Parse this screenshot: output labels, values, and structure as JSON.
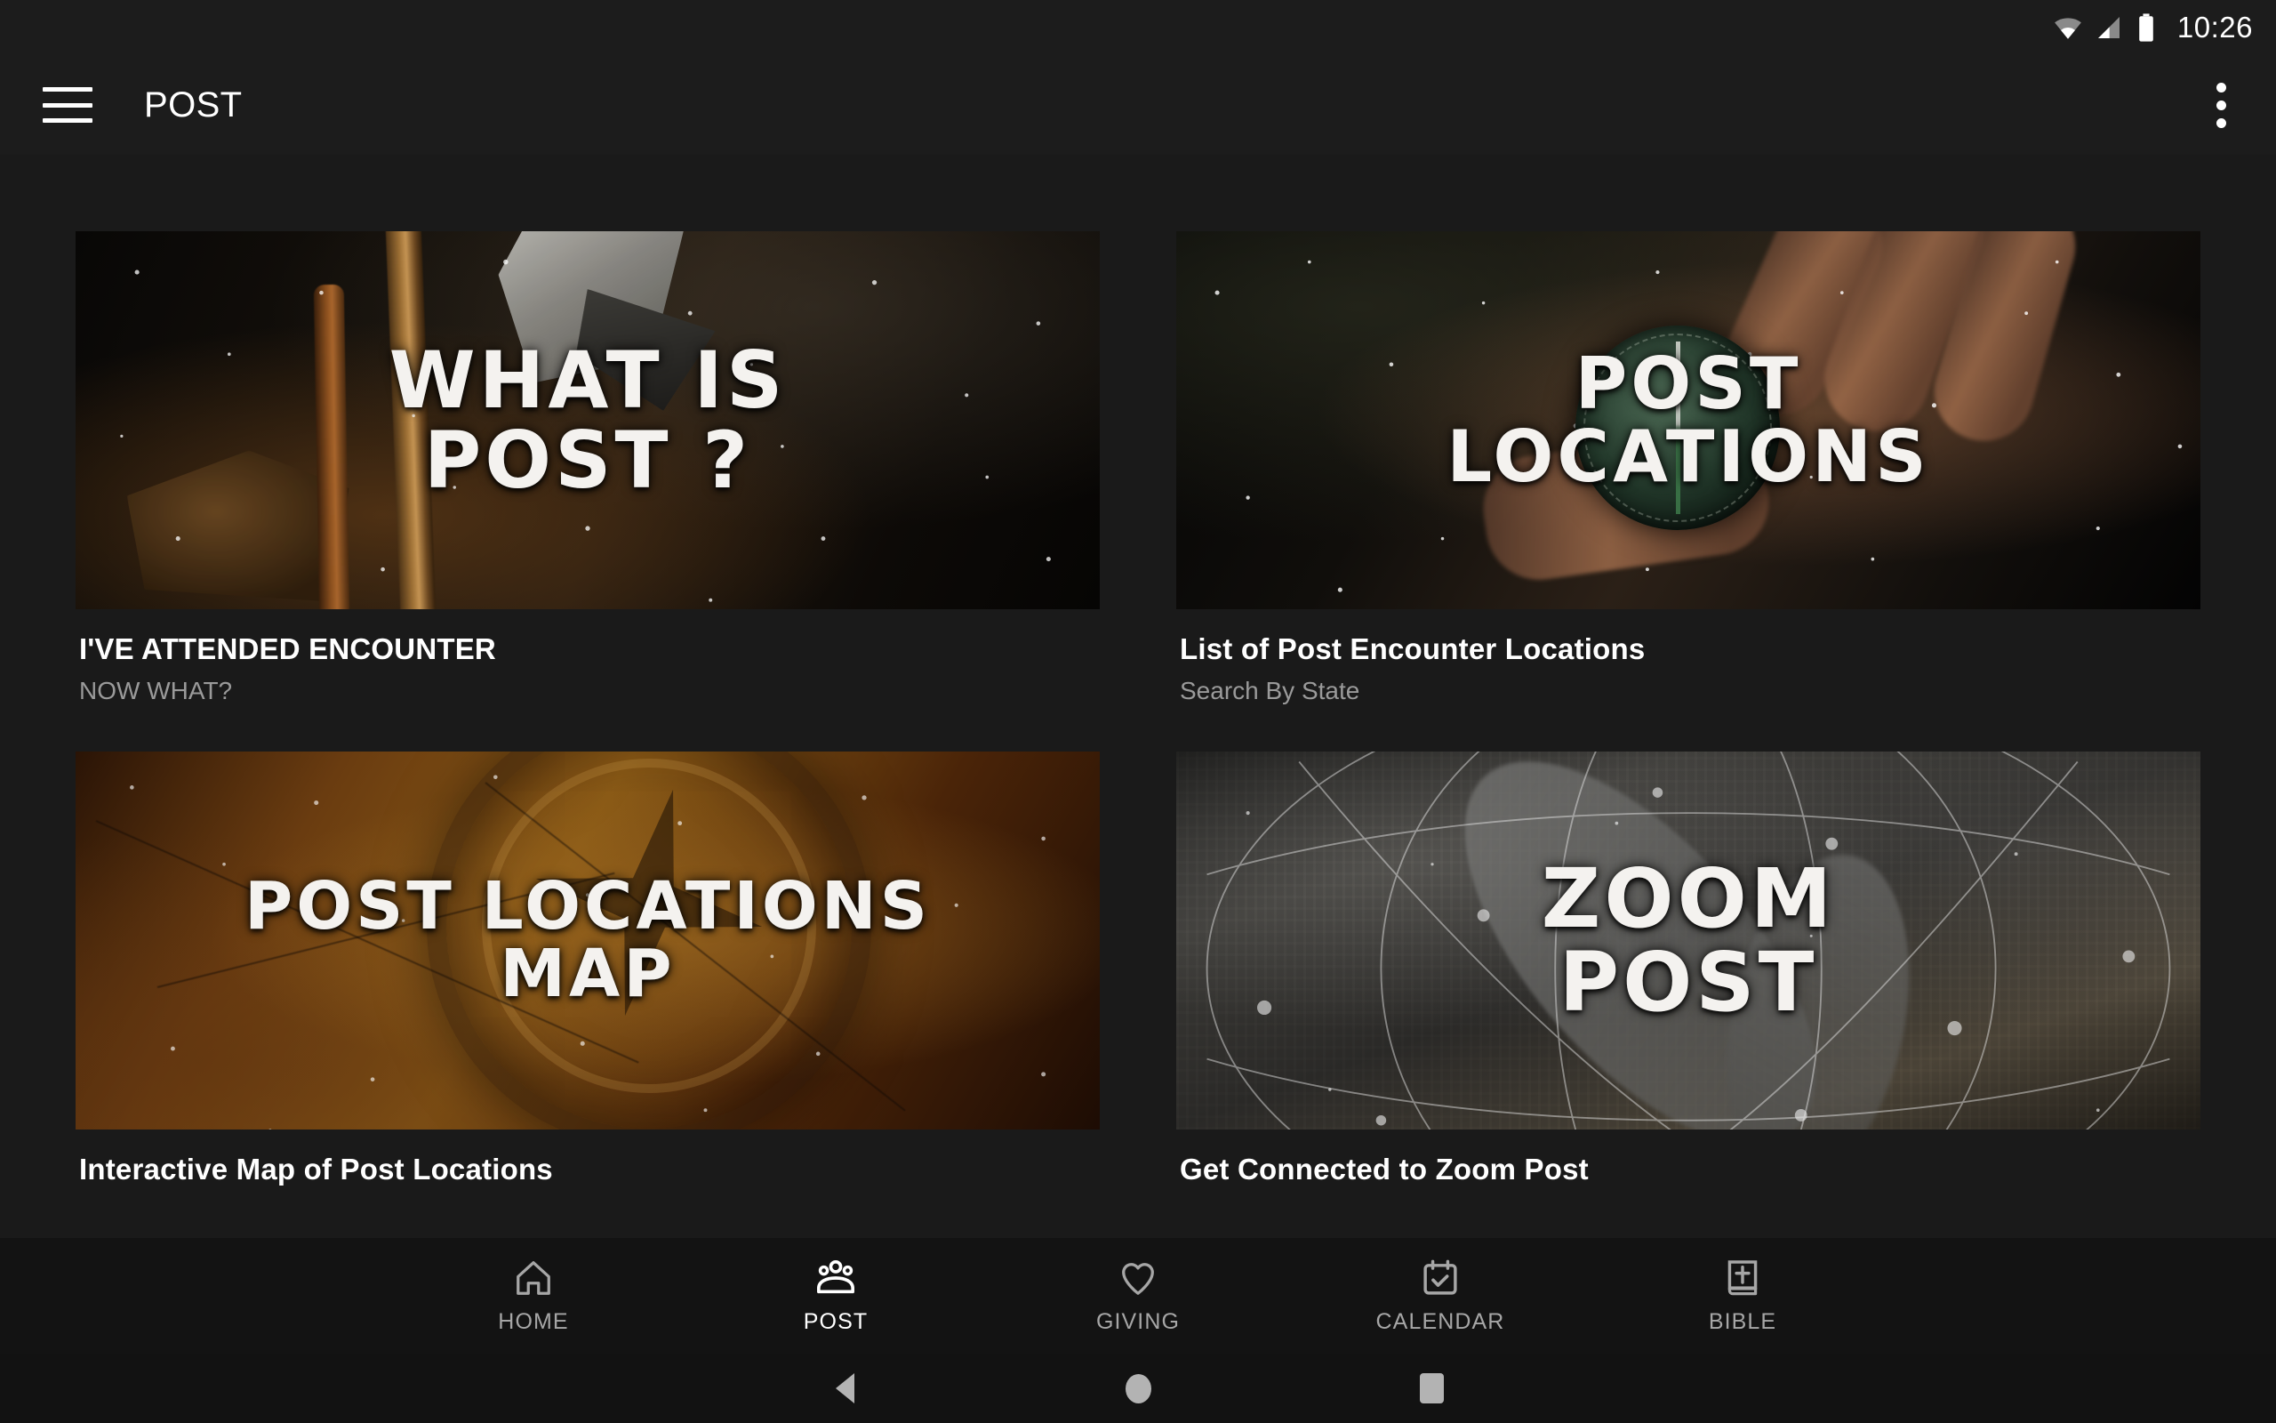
{
  "status_bar": {
    "time": "10:26",
    "icons": [
      "wifi-icon",
      "cellular-signal-icon",
      "battery-icon"
    ]
  },
  "app_bar": {
    "menu_icon": "hamburger-menu-icon",
    "title": "POST",
    "overflow_icon": "more-vertical-icon"
  },
  "cards": [
    {
      "hero_lines": [
        "WHAT IS",
        "POST ?"
      ],
      "title": "I'VE ATTENDED ENCOUNTER",
      "subtitle": "NOW WHAT?"
    },
    {
      "hero_lines": [
        "POST",
        "LOCATIONS"
      ],
      "title": "List of Post Encounter Locations",
      "subtitle": "Search By State"
    },
    {
      "hero_lines": [
        "POST LOCATIONS",
        "MAP"
      ],
      "title": "Interactive Map of Post Locations",
      "subtitle": ""
    },
    {
      "hero_lines": [
        "ZOOM",
        "POST"
      ],
      "title": "Get Connected to Zoom Post",
      "subtitle": ""
    }
  ],
  "bottom_nav": {
    "items": [
      {
        "label": "HOME",
        "icon": "home-icon",
        "active": false
      },
      {
        "label": "POST",
        "icon": "people-icon",
        "active": true
      },
      {
        "label": "GIVING",
        "icon": "heart-icon",
        "active": false
      },
      {
        "label": "CALENDAR",
        "icon": "calendar-check-icon",
        "active": false
      },
      {
        "label": "BIBLE",
        "icon": "bible-book-icon",
        "active": false
      }
    ]
  },
  "android_nav": {
    "back": "back-triangle-icon",
    "home": "home-circle-icon",
    "recents": "recents-square-icon"
  },
  "colors": {
    "background": "#1a1a1a",
    "app_bar": "#1c1c1c",
    "title_text": "#ffffff",
    "subtitle_text": "#9a9a9a",
    "nav_inactive": "#a6a6a6",
    "nav_active": "#ffffff"
  }
}
